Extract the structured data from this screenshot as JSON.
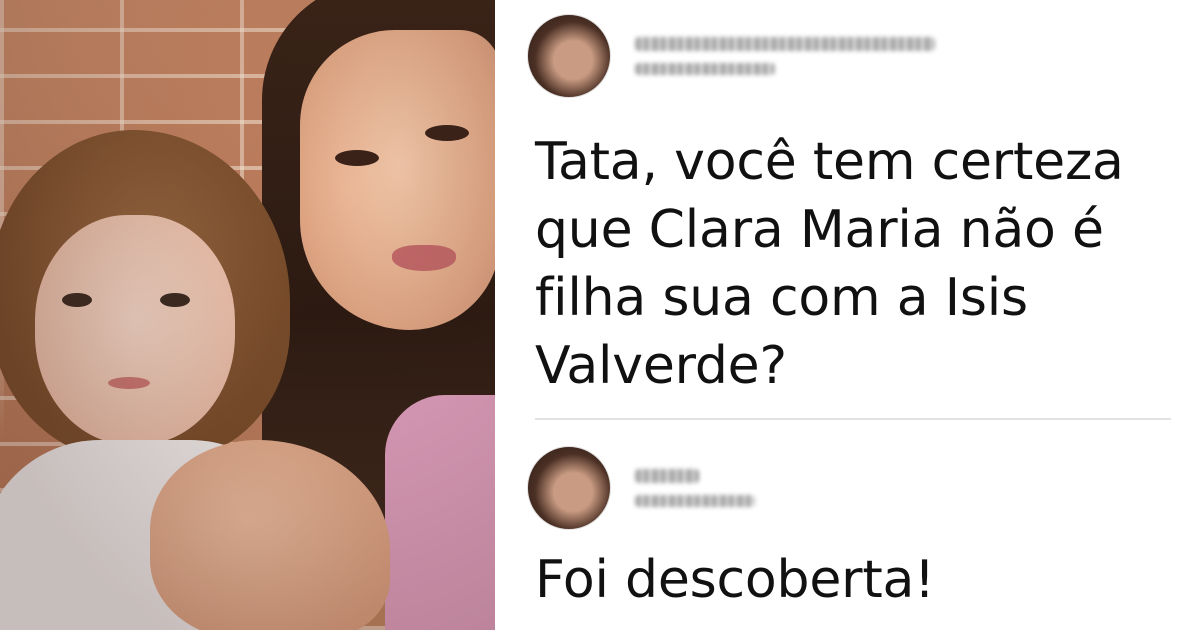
{
  "comments": [
    {
      "avatar_icon": "user-avatar",
      "username": "",
      "timestamp": "",
      "text": "Tata, você tem certeza que Clara Maria não é filha sua com a Isis Valverde?"
    },
    {
      "avatar_icon": "user-avatar",
      "username": "",
      "timestamp": "",
      "text": "Foi descoberta!"
    }
  ],
  "colors": {
    "text": "#111111",
    "divider": "#e2e2e2",
    "background": "#ffffff"
  }
}
